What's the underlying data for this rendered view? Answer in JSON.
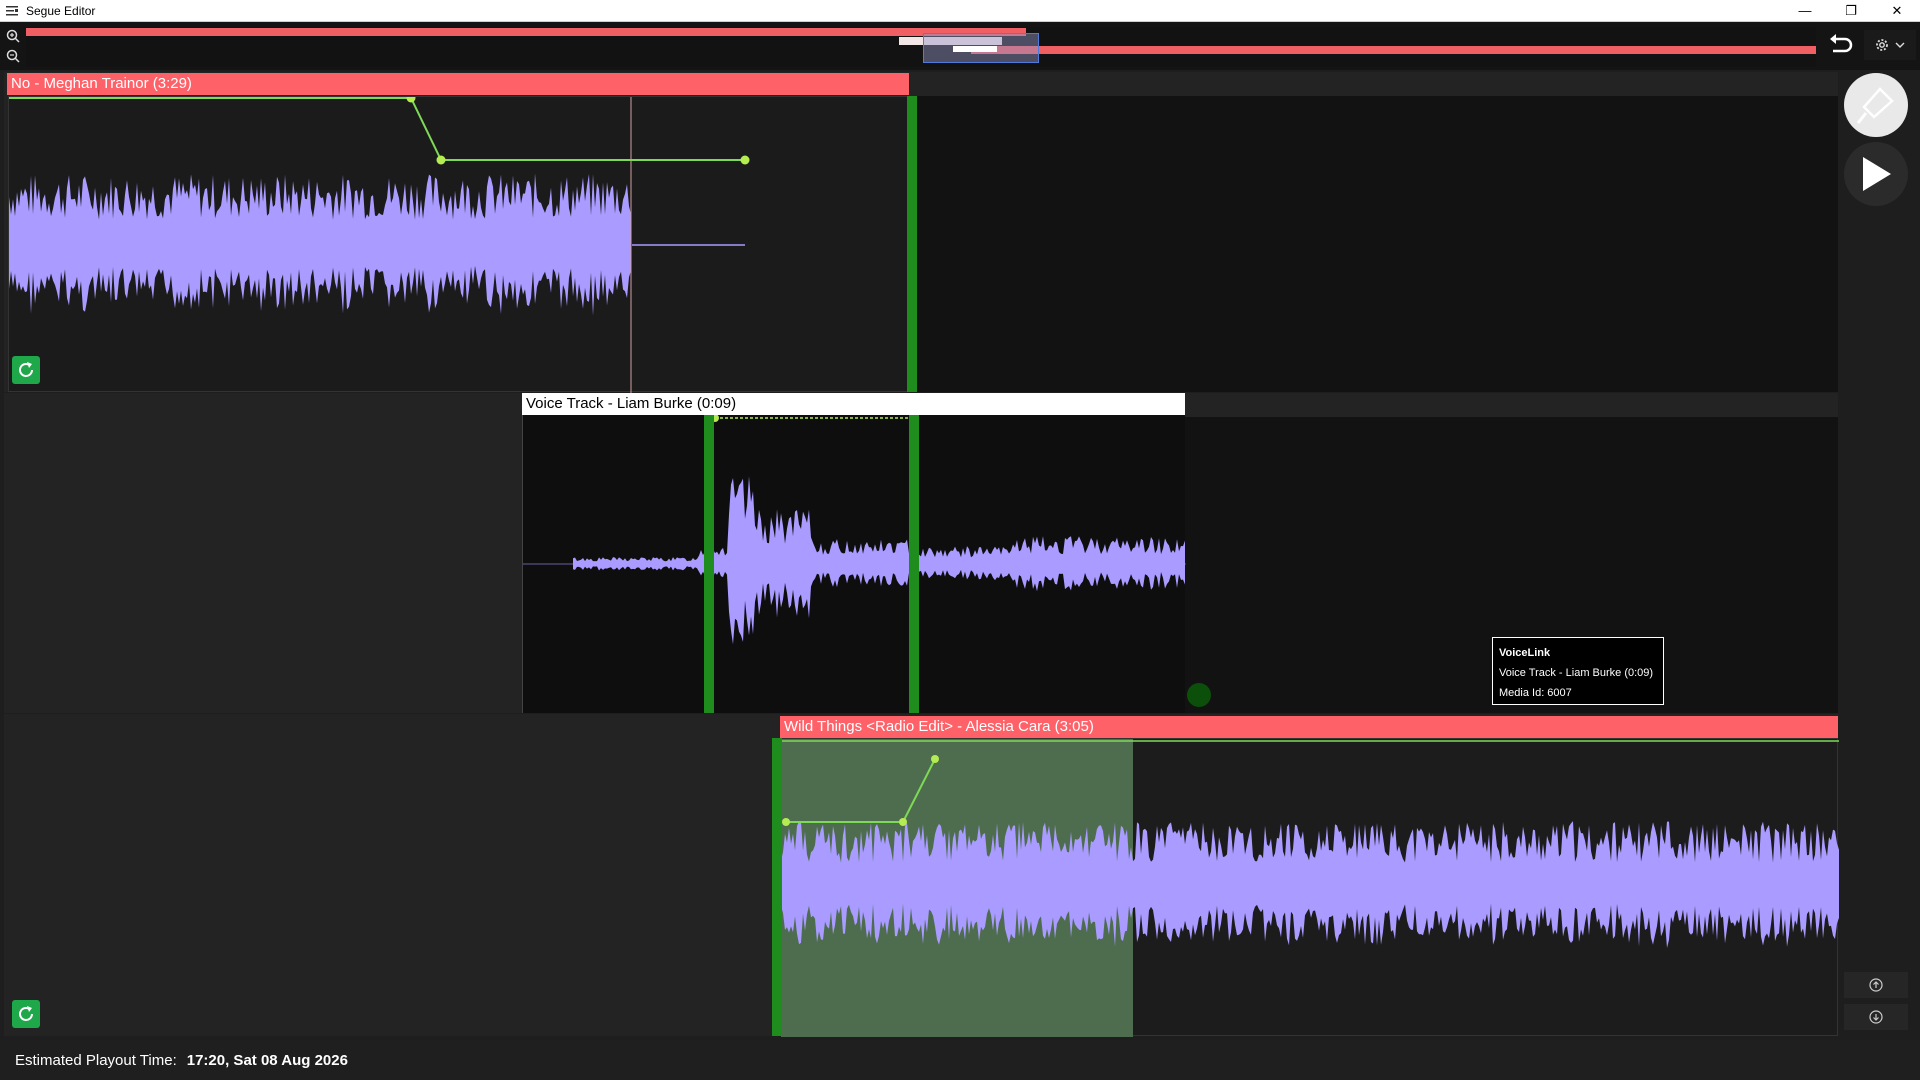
{
  "window": {
    "title": "Segue Editor",
    "controls": {
      "minimize": "—",
      "restore": "❐",
      "close": "✕"
    }
  },
  "overview": {
    "zoom_in_icon": "zoom-in-icon",
    "zoom_out_icon": "zoom-out-icon"
  },
  "tracks": [
    {
      "title": "No - Meghan Trainor (3:29)",
      "color": "#ff6168"
    },
    {
      "title": "Voice Track - Liam Burke (0:09)",
      "color": "#ffffff"
    },
    {
      "title": "Wild Things <Radio Edit> - Alessia Cara (3:05)",
      "color": "#ff6168"
    }
  ],
  "tooltip": {
    "title": "VoiceLink",
    "line1": "Voice Track - Liam Burke (0:09)",
    "line2": "Media Id: 6007"
  },
  "footer": {
    "label": "Estimated Playout Time:",
    "value": "17:20, Sat 08 Aug 2026"
  },
  "colors": {
    "accent_red": "#ff6168",
    "waveform": "#a99bff",
    "envelope": "#7ed957",
    "marker": "#1e8d1e"
  }
}
